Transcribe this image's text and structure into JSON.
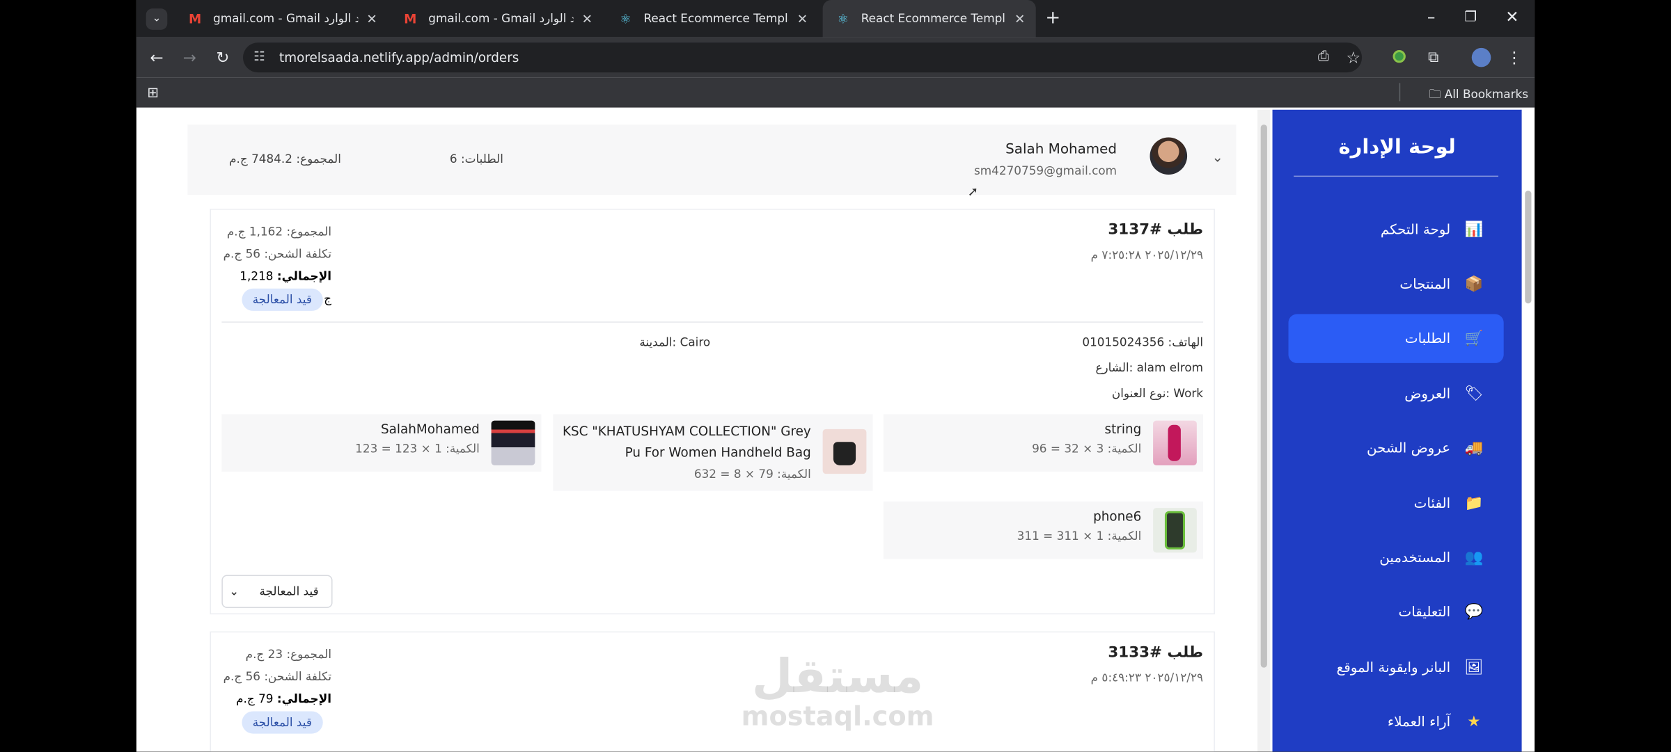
{
  "browser": {
    "tabs": [
      {
        "title": "‏gmail.com - Gmail البريد الوارد",
        "icon": "gmail-icon"
      },
      {
        "title": "‏gmail.com - Gmail البريد الوارد",
        "icon": "gmail-icon"
      },
      {
        "title": "React Ecommerce Template",
        "icon": "react-icon"
      },
      {
        "title": "React Ecommerce Template",
        "icon": "react-icon"
      }
    ],
    "url": "tmorelsaada.netlify.app/admin/orders",
    "bookmarks_label": "All Bookmarks"
  },
  "sidebar": {
    "title": "لوحة الإدارة",
    "items": [
      {
        "label": "لوحة التحكم",
        "icon": "chart-icon"
      },
      {
        "label": "المنتجات",
        "icon": "box-icon"
      },
      {
        "label": "الطلبات",
        "icon": "cart-icon",
        "active": true
      },
      {
        "label": "العروض",
        "icon": "tag-icon"
      },
      {
        "label": "عروض الشحن",
        "icon": "truck-icon"
      },
      {
        "label": "الفئات",
        "icon": "folder-icon"
      },
      {
        "label": "المستخدمين",
        "icon": "users-icon"
      },
      {
        "label": "التعليقات",
        "icon": "comment-icon"
      },
      {
        "label": "البانر وايقونة الموقع",
        "icon": "image-icon"
      },
      {
        "label": "آراء العملاء",
        "icon": "star-icon"
      }
    ]
  },
  "user_group": {
    "name": "Salah Mohamed",
    "email": "sm4270759@gmail.com",
    "orders_count": "الطلبات: 6",
    "total": "المجموع: 7484.2 ج.م"
  },
  "orders": [
    {
      "number": "طلب #3137",
      "date": "٢٠٢٥/١٢/٢٩ ٧:٢٥:٢٨ م",
      "subtotal": "المجموع: 1,162 ج.م",
      "shipping": "تكلفة الشحن: 56 ج.م",
      "total_label": "الإجمالي:",
      "total_value": " 1,218 ج.م",
      "status": "قيد المعالجة",
      "phone": "الهاتف: 01015024356",
      "city": "المدينة: Cairo",
      "street": "الشارع: alam elrom",
      "address_type": "نوع العنوان: Work",
      "products": [
        {
          "name": "string",
          "qty": "الكمية: 3 × 32 = 96"
        },
        {
          "name": "KSC \"KHATUSHYAM COLLECTION\" Grey Pu For Women Handheld Bag",
          "qty": "الكمية: 79 × 8 = 632"
        },
        {
          "name": "SalahMohamed",
          "qty": "الكمية: 1 × 123 = 123"
        },
        {
          "name": "phone6",
          "qty": "الكمية: 1 × 311 = 311"
        }
      ],
      "status_select": "قيد المعالجة"
    },
    {
      "number": "طلب #3133",
      "date": "٢٠٢٥/١٢/٢٩ ٥:٤٩:٢٣ م",
      "subtotal": "المجموع: 23 ج.م",
      "shipping": "تكلفة الشحن: 56 ج.م",
      "total_label": "الإجمالي:",
      "total_value": " 79 ج.م",
      "status": "قيد المعالجة"
    }
  ],
  "watermark": {
    "arabic": "مستقل",
    "latin": "mostaql.com"
  }
}
